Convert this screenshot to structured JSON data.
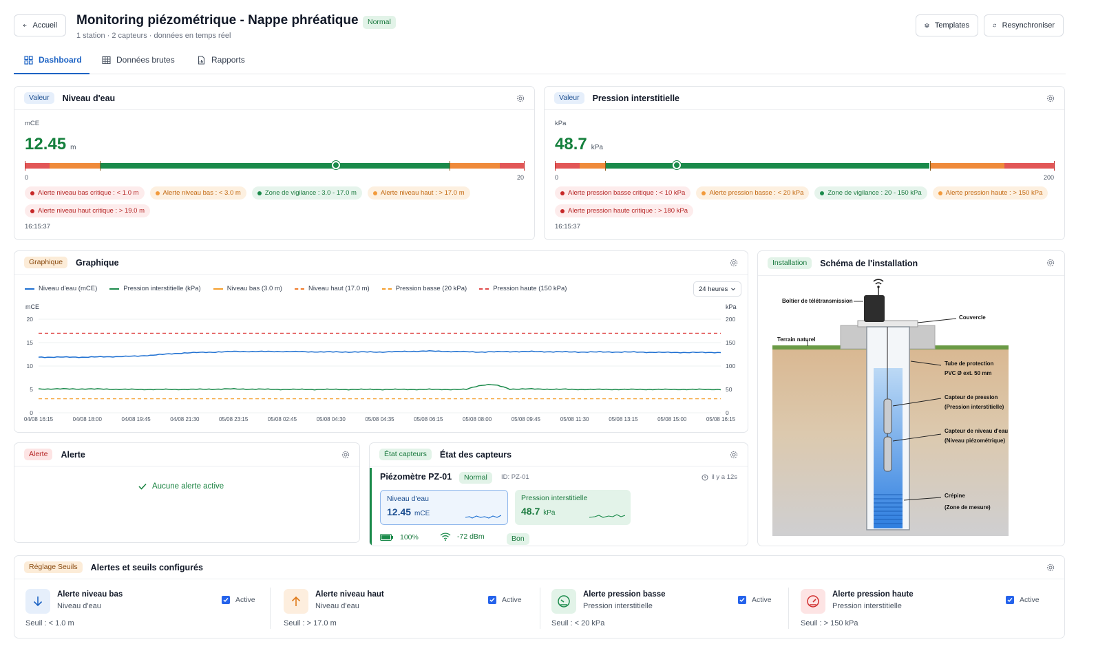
{
  "header": {
    "back_label": "Accueil",
    "title": "Monitoring piézométrique - Nappe phréatique",
    "status": "Normal",
    "subtitle": "1 station · 2 capteurs · données en temps réel",
    "templates_label": "Templates",
    "resync_label": "Resynchroniser"
  },
  "tabs": [
    {
      "label": "Dashboard",
      "active": true,
      "icon": "grid-icon"
    },
    {
      "label": "Données brutes",
      "active": false,
      "icon": "table-icon"
    },
    {
      "label": "Rapports",
      "active": false,
      "icon": "report-icon"
    }
  ],
  "water_level": {
    "badge": "Valeur",
    "title": "Niveau d'eau",
    "unit_label": "mCE",
    "value": "12.45",
    "unit": "m",
    "scale_min": "0",
    "scale_max": "20",
    "value_num": 12.45,
    "thresholds": [
      1.0,
      3.0,
      17.0,
      19.0
    ],
    "chips": [
      {
        "text": "Alerte niveau bas critique : < 1.0 m",
        "level": "red"
      },
      {
        "text": "Alerte niveau bas : < 3.0 m",
        "level": "orange"
      },
      {
        "text": "Zone de vigilance : 3.0 - 17.0 m",
        "level": "green"
      },
      {
        "text": "Alerte niveau haut : > 17.0 m",
        "level": "orange"
      },
      {
        "text": "Alerte niveau haut critique : > 19.0 m",
        "level": "red"
      }
    ],
    "time": "16:15:37"
  },
  "pressure": {
    "badge": "Valeur",
    "title": "Pression interstitielle",
    "unit_label": "kPa",
    "value": "48.7",
    "unit": "kPa",
    "scale_min": "0",
    "scale_max": "200",
    "value_num": 48.7,
    "thresholds": [
      10,
      20,
      150,
      180
    ],
    "chips": [
      {
        "text": "Alerte pression basse critique : < 10 kPa",
        "level": "red"
      },
      {
        "text": "Alerte pression basse : < 20 kPa",
        "level": "orange"
      },
      {
        "text": "Zone de vigilance : 20 - 150 kPa",
        "level": "green"
      },
      {
        "text": "Alerte pression haute : > 150 kPa",
        "level": "orange"
      },
      {
        "text": "Alerte pression haute critique : > 180 kPa",
        "level": "red"
      }
    ],
    "time": "16:15:37"
  },
  "graph": {
    "badge": "Graphique",
    "title": "Graphique",
    "range_select": "24 heures",
    "legend": [
      {
        "label": "Niveau d'eau (mCE)",
        "color": "#1d6fd1",
        "style": "solid"
      },
      {
        "label": "Pression interstitielle (kPa)",
        "color": "#1a8a4a",
        "style": "solid"
      },
      {
        "label": "Niveau bas (3.0 m)",
        "color": "#f59e2b",
        "style": "solid"
      },
      {
        "label": "Niveau haut (17.0 m)",
        "color": "#f07a2a",
        "style": "dashed"
      },
      {
        "label": "Pression basse (20 kPa)",
        "color": "#f59e2b",
        "style": "dashed"
      },
      {
        "label": "Pression haute (150 kPa)",
        "color": "#e04848",
        "style": "dashed"
      }
    ],
    "left_axis_label": "mCE",
    "right_axis_label": "kPa",
    "left_ticks": [
      "20",
      "15",
      "10",
      "5",
      "0"
    ],
    "right_ticks": [
      "200",
      "150",
      "100",
      "50",
      "0"
    ],
    "x_ticks": [
      "04/08 16:15",
      "04/08 18:00",
      "04/08 19:45",
      "04/08 21:30",
      "05/08 23:15",
      "05/08 02:45",
      "05/08 04:30",
      "05/08 04:35",
      "05/08 06:15",
      "05/08 08:00",
      "05/08 09:45",
      "05/08 11:30",
      "05/08 13:15",
      "05/08 15:00",
      "05/08 16:15"
    ]
  },
  "chart_data": {
    "type": "line",
    "title": "Graphique",
    "xlabel": "",
    "ylabel": "mCE",
    "ylabel_right": "kPa",
    "ylim": [
      0,
      20
    ],
    "ylim_right": [
      0,
      200
    ],
    "x": [
      "04/08 16:15",
      "04/08 18:00",
      "04/08 19:45",
      "04/08 21:30",
      "05/08 23:15",
      "05/08 02:45",
      "05/08 04:30",
      "05/08 04:35",
      "05/08 06:15",
      "05/08 08:00",
      "05/08 09:45",
      "05/08 11:30",
      "05/08 13:15",
      "05/08 15:00",
      "05/08 16:15"
    ],
    "series": [
      {
        "name": "Niveau d'eau (mCE)",
        "axis": "left",
        "values": [
          11.9,
          11.9,
          12.1,
          12.8,
          13.1,
          13.1,
          13.0,
          13.0,
          13.2,
          13.0,
          13.1,
          13.0,
          13.0,
          12.9,
          12.9
        ]
      },
      {
        "name": "Pression interstitielle (kPa)",
        "axis": "left",
        "values": [
          5.1,
          5.1,
          5.0,
          5.0,
          5.1,
          5.0,
          5.0,
          5.0,
          5.0,
          5.0,
          5.1,
          5.0,
          5.0,
          5.0,
          5.0
        ]
      }
    ],
    "reference_lines": [
      {
        "name": "Niveau bas (3.0 m)",
        "axis": "left",
        "value": 3.0
      },
      {
        "name": "Niveau haut (17.0 m)",
        "axis": "left",
        "value": 17.0
      }
    ],
    "legend": "top-left",
    "grid": true
  },
  "alert": {
    "badge": "Alerte",
    "title": "Alerte",
    "message": "Aucune alerte active"
  },
  "sensors": {
    "badge": "État capteurs",
    "title": "État des capteurs",
    "station_name": "Piézomètre PZ-01",
    "station_status": "Normal",
    "station_id": "ID: PZ-01",
    "last_update": "il y a 12s",
    "level_label": "Niveau d'eau",
    "level_value": "12.45",
    "level_unit": "mCE",
    "pressure_label": "Pression interstitielle",
    "pressure_value": "48.7",
    "pressure_unit": "kPa",
    "battery": "100%",
    "signal": "-72 dBm",
    "quality": "Bon"
  },
  "installation": {
    "badge": "Installation",
    "title": "Schéma de l'installation",
    "labels": {
      "boitier": "Boîtier de télétransmission",
      "couvercle": "Couvercle",
      "terrain": "Terrain naturel",
      "tube_1": "Tube de protection",
      "tube_2": "PVC Ø ext. 50 mm",
      "capt_p_1": "Capteur de pression",
      "capt_p_2": "(Pression interstitielle)",
      "capt_n_1": "Capteur de niveau d'eau",
      "capt_n_2": "(Niveau piézométrique)",
      "crepine_1": "Crépine",
      "crepine_2": "(Zone de mesure)"
    }
  },
  "thresholds": {
    "badge": "Réglage Seuils",
    "title": "Alertes et seuils configurés",
    "items": [
      {
        "name": "Alerte niveau bas",
        "sensor": "Niveau d'eau",
        "active": "Active",
        "seuil": "Seuil : < 1.0 m",
        "icon": "arrow-down-icon"
      },
      {
        "name": "Alerte niveau haut",
        "sensor": "Niveau d'eau",
        "active": "Active",
        "seuil": "Seuil : > 17.0 m",
        "icon": "arrow-up-icon"
      },
      {
        "name": "Alerte pression basse",
        "sensor": "Pression interstitielle",
        "active": "Active",
        "seuil": "Seuil : < 20 kPa",
        "icon": "gauge-low-icon"
      },
      {
        "name": "Alerte pression haute",
        "sensor": "Pression interstitielle",
        "active": "Active",
        "seuil": "Seuil : > 150 kPa",
        "icon": "gauge-high-icon"
      }
    ]
  }
}
